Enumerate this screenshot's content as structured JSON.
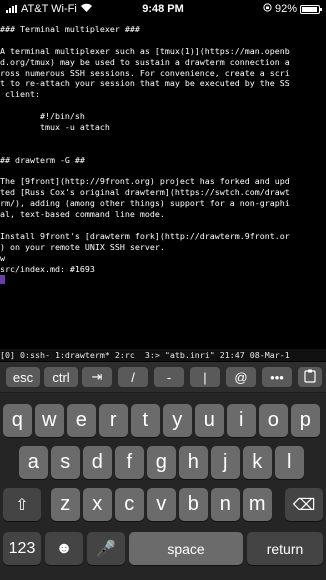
{
  "status": {
    "carrier": "AT&T Wi-Fi",
    "time": "9:48 PM",
    "battery_text": "92%",
    "battery_level": 0.92
  },
  "terminal": {
    "lines": [
      "### Terminal multiplexer ###",
      "",
      "A terminal multiplexer such as [tmux(1)](https://man.openb",
      "d.org/tmux) may be used to sustain a drawterm connection a",
      "ross numerous SSH sessions. For convenience, create a scri",
      "t to re-attach your session that may be executed by the SS",
      " client:",
      "",
      "        #!/bin/sh",
      "        tmux -u attach",
      "",
      "",
      "## drawterm -G ##",
      "",
      "The [9front](http://9front.org) project has forked and upd",
      "ted [Russ Cox's original drawterm](https://swtch.com/drawt",
      "rm/), adding (among other things) support for a non-graphi",
      "al, text-based command line mode.",
      "",
      "Install 9front's [drawterm fork](http://drawterm.9front.or",
      ") on your remote UNIX SSH server.",
      "w",
      "src/index.md: #1693"
    ]
  },
  "tmux_status": "[0] 0:ssh- 1:drawterm* 2:rc  3:> \"atb.inri\" 21:47 08-Mar-1",
  "accessory": {
    "esc": "esc",
    "ctrl": "ctrl",
    "tab": "⇥",
    "slash": "/",
    "dash": "-",
    "pipe": "|",
    "at": "@",
    "more": "•••",
    "paste_icon": "clipboard-icon"
  },
  "keyboard": {
    "row1": [
      "q",
      "w",
      "e",
      "r",
      "t",
      "y",
      "u",
      "i",
      "o",
      "p"
    ],
    "row2": [
      "a",
      "s",
      "d",
      "f",
      "g",
      "h",
      "j",
      "k",
      "l"
    ],
    "row3": [
      "z",
      "x",
      "c",
      "v",
      "b",
      "n",
      "m"
    ],
    "shift": "⇧",
    "delete": "⌫",
    "numbers": "123",
    "emoji": "☻",
    "mic": "🎤",
    "space": "space",
    "return": "return"
  }
}
